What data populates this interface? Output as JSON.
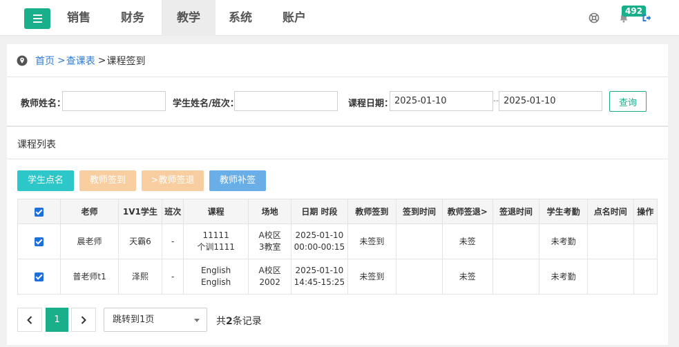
{
  "nav": {
    "items": [
      {
        "label": "销售",
        "active": false
      },
      {
        "label": "财务",
        "active": false
      },
      {
        "label": "教学",
        "active": true
      },
      {
        "label": "系统",
        "active": false
      },
      {
        "label": "账户",
        "active": false
      }
    ],
    "notification_count": "492"
  },
  "breadcrumb": {
    "home": "首页",
    "sep1": ">",
    "level2": "查课表",
    "sep2": ">",
    "current": "课程签到"
  },
  "filters": {
    "teacher_label": "教师姓名：",
    "teacher_value": "",
    "student_label": "学生姓名/班次：",
    "student_value": "",
    "date_label": "课程日期：",
    "date_from": "2025-01-10",
    "date_sep": "--",
    "date_to": "2025-01-10",
    "query_label": "查询"
  },
  "section_title": "课程列表",
  "actions": [
    {
      "label": "学生点名",
      "color": "#2ec7c9"
    },
    {
      "label": "教师签到",
      "color": "#f8cea0"
    },
    {
      "label": ">教师签退",
      "color": "#f8cea0"
    },
    {
      "label": "教师补签",
      "color": "#6aaee8"
    }
  ],
  "table": {
    "headers": [
      "老师",
      "1V1学生",
      "班次",
      "课程",
      "场地",
      "日期 时段",
      "教师签到",
      "签到时间",
      "教师签退>",
      "签退时间",
      "学生考勤",
      "点名时间",
      "操作"
    ],
    "rows": [
      {
        "teacher": "晨老师",
        "student": "天霸6",
        "class": "-",
        "course1": "11111",
        "course2": "个训1111",
        "venue1": "A校区",
        "venue2": "3教室",
        "date": "2025-01-10",
        "time": "00:00-00:15",
        "sign_in": "未签到",
        "sign_in_time": "",
        "sign_out": "未签",
        "sign_out_time": "",
        "attendance": "未考勤",
        "rollcall_time": "",
        "op": ""
      },
      {
        "teacher": "普老师t1",
        "student": "泽熙",
        "class": "-",
        "course1": "English",
        "course2": "English",
        "venue1": "A校区",
        "venue2": "2002",
        "date": "2025-01-10",
        "time": "14:45-15:25",
        "sign_in": "未签到",
        "sign_in_time": "",
        "sign_out": "未签",
        "sign_out_time": "",
        "attendance": "未考勤",
        "rollcall_time": "",
        "op": ""
      }
    ]
  },
  "pagination": {
    "current_page": "1",
    "jump_label": "跳转到1页",
    "total_prefix": "共",
    "total_count": "2",
    "total_suffix": "条记录"
  },
  "colors": {
    "brand": "#1aaf8b",
    "link": "#2e7bd1",
    "checkbox": "#1e6fd9"
  }
}
